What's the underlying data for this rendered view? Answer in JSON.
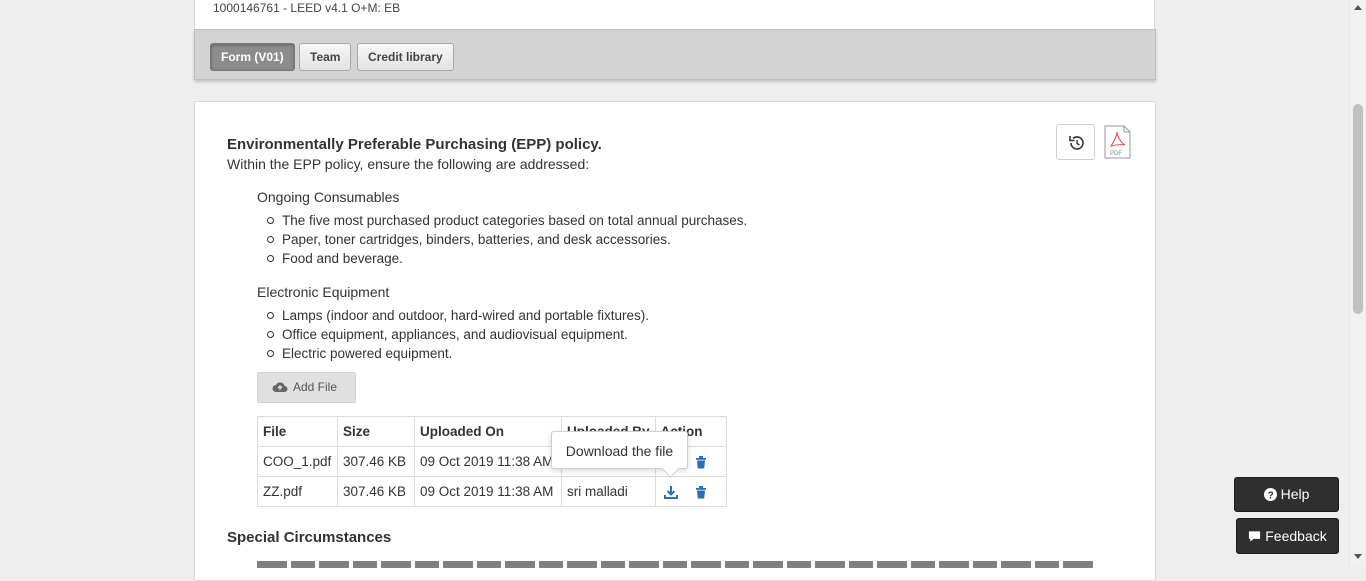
{
  "header": {
    "project_id": "1000146761 - LEED v4.1 O+M: EB"
  },
  "tabs": [
    {
      "label": "Form (V01)",
      "active": true
    },
    {
      "label": "Team",
      "active": false
    },
    {
      "label": "Credit library",
      "active": false
    }
  ],
  "section": {
    "title": "Environmentally Preferable Purchasing (EPP) policy.",
    "intro": "Within the EPP policy, ensure the following are addressed:",
    "groups": [
      {
        "label": "Ongoing Consumables",
        "items": [
          "The five most purchased product categories based on total annual purchases.",
          "Paper, toner cartridges, binders, batteries, and desk accessories.",
          "Food and beverage."
        ]
      },
      {
        "label": "Electronic Equipment",
        "items": [
          "Lamps (indoor and outdoor, hard-wired and portable fixtures).",
          "Office equipment, appliances, and audiovisual equipment.",
          "Electric powered equipment."
        ]
      }
    ]
  },
  "icons": {
    "history": "history-icon",
    "pdf": "pdf-file-icon",
    "upload": "cloud-upload-icon",
    "download": "download-icon",
    "delete": "trash-icon",
    "help": "question-circle-icon",
    "feedback": "comment-icon"
  },
  "add_file_label": "Add File",
  "files_table": {
    "columns": [
      "File",
      "Size",
      "Uploaded On",
      "Uploaded By",
      "Action"
    ],
    "rows": [
      {
        "file": "COO_1.pdf",
        "size": "307.46 KB",
        "uploaded_on": "09 Oct 2019 11:38 AM",
        "uploaded_by": ""
      },
      {
        "file": "ZZ.pdf",
        "size": "307.46 KB",
        "uploaded_on": "09 Oct 2019 11:38 AM",
        "uploaded_by": "sri malladi"
      }
    ]
  },
  "tooltip": "Download the file",
  "special_title": "Special Circumstances",
  "help_label": "Help",
  "feedback_label": "Feedback",
  "colors": {
    "action_blue": "#2a6ebb",
    "dark_button": "#2f2f2f",
    "active_tab": "#8c8c8c"
  }
}
